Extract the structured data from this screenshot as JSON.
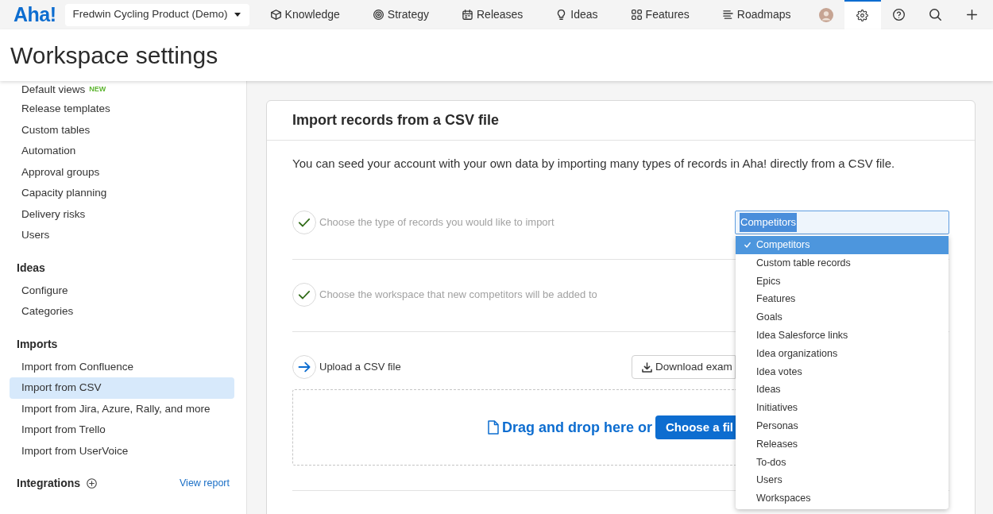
{
  "top_nav": {
    "logo": "Aha!",
    "workspace_switcher": "Fredwin Cycling Product (Demo)",
    "items": [
      {
        "label": "Knowledge",
        "selected": false
      },
      {
        "label": "Strategy",
        "selected": false
      },
      {
        "label": "Releases",
        "selected": false
      },
      {
        "label": "Ideas",
        "selected": false
      },
      {
        "label": "Features",
        "selected": false
      },
      {
        "label": "Roadmaps",
        "selected": false
      }
    ],
    "tools": [
      {
        "kind": "avatar",
        "selected": false
      },
      {
        "kind": "settings",
        "selected": true
      },
      {
        "kind": "help",
        "selected": false
      },
      {
        "kind": "search",
        "selected": false
      },
      {
        "kind": "add",
        "selected": false
      }
    ]
  },
  "page_title": "Workspace settings",
  "sidebar": {
    "groups": [
      {
        "items": [
          {
            "label": "Default views",
            "badge": "NEW",
            "selected": false
          },
          {
            "label": "Release templates",
            "selected": false
          },
          {
            "label": "Custom tables",
            "selected": false
          },
          {
            "label": "Automation",
            "selected": false
          },
          {
            "label": "Approval groups",
            "selected": false
          },
          {
            "label": "Capacity planning",
            "selected": false
          },
          {
            "label": "Delivery risks",
            "selected": false
          },
          {
            "label": "Users",
            "selected": false
          }
        ]
      },
      {
        "title": "Ideas",
        "items": [
          {
            "label": "Configure",
            "selected": false
          },
          {
            "label": "Categories",
            "selected": false
          }
        ]
      },
      {
        "title": "Imports",
        "items": [
          {
            "label": "Import from Confluence",
            "selected": false
          },
          {
            "label": "Import from CSV",
            "selected": true
          },
          {
            "label": "Import from Jira, Azure, Rally, and more",
            "selected": false
          },
          {
            "label": "Import from Trello",
            "selected": false
          },
          {
            "label": "Import from UserVoice",
            "selected": false
          }
        ]
      },
      {
        "title": "Integrations",
        "add_button": true,
        "link": "View report"
      }
    ]
  },
  "import_card": {
    "title": "Import records from a CSV file",
    "intro": "You can seed your account with your own data by importing many types of records in Aha! directly from a CSV file.",
    "steps": [
      {
        "label": "Choose the type of records you would like to import",
        "done": true,
        "select": {
          "value": "Competitors",
          "expanded": true,
          "options": [
            {
              "label": "Competitors",
              "selected": true
            },
            {
              "label": "Custom table records",
              "selected": false
            },
            {
              "label": "Epics",
              "selected": false
            },
            {
              "label": "Features",
              "selected": false
            },
            {
              "label": "Goals",
              "selected": false
            },
            {
              "label": "Idea Salesforce links",
              "selected": false
            },
            {
              "label": "Idea organizations",
              "selected": false
            },
            {
              "label": "Idea votes",
              "selected": false
            },
            {
              "label": "Ideas",
              "selected": false
            },
            {
              "label": "Initiatives",
              "selected": false
            },
            {
              "label": "Personas",
              "selected": false
            },
            {
              "label": "Releases",
              "selected": false
            },
            {
              "label": "To-dos",
              "selected": false
            },
            {
              "label": "Users",
              "selected": false
            },
            {
              "label": "Workspaces",
              "selected": false
            }
          ]
        }
      },
      {
        "label": "Choose the workspace that new competitors will be added to",
        "done": true
      },
      {
        "label": "Upload a CSV file",
        "done": false,
        "button": "Download exam",
        "dropzone": {
          "text": "Drag and drop here or",
          "button": "Choose a fil"
        }
      }
    ]
  }
}
